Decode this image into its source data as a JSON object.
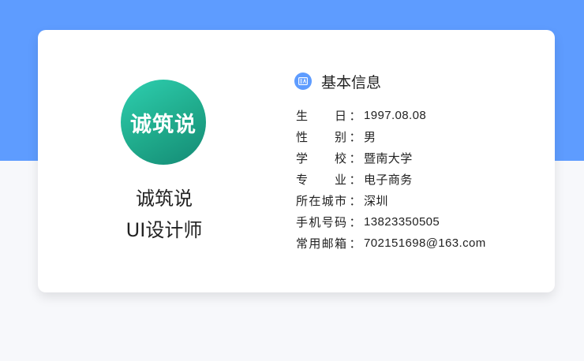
{
  "profile": {
    "logo_text": "诚筑说",
    "logo_mark": "®",
    "name": "诚筑说",
    "title": "UI设计师"
  },
  "info": {
    "section_title": "基本信息",
    "section_icon": "id-card-icon",
    "rows": [
      {
        "label": "生 日",
        "value": "1997.08.08"
      },
      {
        "label": "性 别",
        "value": "男"
      },
      {
        "label": "学 校",
        "value": "暨南大学"
      },
      {
        "label": "专 业",
        "value": "电子商务"
      },
      {
        "label": "所在城市",
        "value": "深圳"
      },
      {
        "label": "手机号码",
        "value": "13823350505"
      },
      {
        "label": "常用邮箱",
        "value": "702151698@163.com"
      }
    ],
    "colon": "："
  },
  "colors": {
    "accent": "#5e9cff",
    "logo_green": "#1faa8b"
  }
}
